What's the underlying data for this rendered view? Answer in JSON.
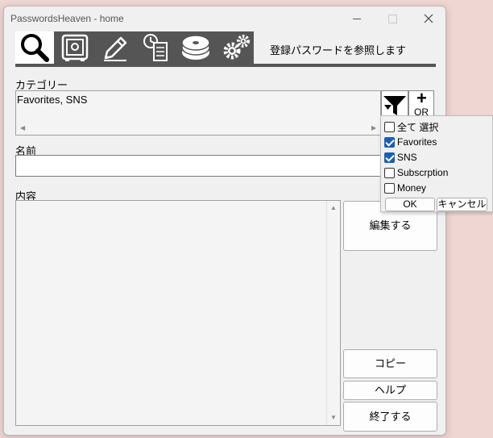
{
  "window": {
    "title": "PasswordsHeaven - home",
    "controls": [
      "minimize-icon",
      "maximize-icon",
      "close-icon"
    ]
  },
  "toolbar": {
    "tools": [
      {
        "name": "search",
        "icon": "magnifier-icon",
        "active": true
      },
      {
        "name": "vault",
        "icon": "safe-icon",
        "active": false
      },
      {
        "name": "edit",
        "icon": "pencil-icon",
        "active": false
      },
      {
        "name": "history",
        "icon": "clock-document-icon",
        "active": false
      },
      {
        "name": "backup",
        "icon": "disc-icon",
        "active": false
      },
      {
        "name": "settings",
        "icon": "gears-icon",
        "active": false
      }
    ],
    "hint": "登録パスワードを参照します"
  },
  "category": {
    "label": "カテゴリー",
    "value": "Favorites, SNS",
    "filter_icon": "funnel-icon",
    "or_button": {
      "plus": "+",
      "label": "OR"
    }
  },
  "filter_popup": {
    "options": [
      {
        "label": "全て 選択",
        "checked": false
      },
      {
        "label": "Favorites",
        "checked": true
      },
      {
        "label": "SNS",
        "checked": true
      },
      {
        "label": "Subscrption",
        "checked": false
      },
      {
        "label": "Money",
        "checked": false
      }
    ],
    "ok_label": "OK",
    "cancel_label": "キャンセル"
  },
  "name": {
    "label": "名前",
    "value": ""
  },
  "content": {
    "label": "内容",
    "value": ""
  },
  "buttons": {
    "edit": "編集する",
    "copy": "コピー",
    "help": "ヘルプ",
    "exit": "終了する"
  },
  "colors": {
    "accent": "#1a5fb4",
    "toolbar": "#555555",
    "window_bg": "#f0f0f0",
    "desktop_bg": "#f0d6d2"
  }
}
